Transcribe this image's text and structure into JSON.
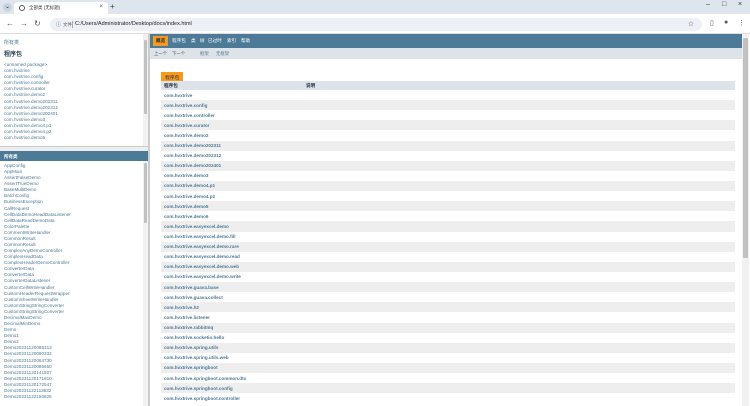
{
  "browser": {
    "tab_title": "全部类 (无标题)",
    "new_tab": "+",
    "omnibox_label": "文件",
    "url": "C:/Users/Administrator/Desktop/docs/index.html"
  },
  "left": {
    "all_packages": "所有类",
    "packages_heading": "程序包",
    "packages": [
      "<unnamed package>",
      "com.hvxtrive",
      "com.hvxtrive.config",
      "com.hvxtrive.controller",
      "com.hvxtrive.curator",
      "com.hvxtrive.demo2",
      "com.hvxtrive.demo202311",
      "com.hvxtrive.demo202312",
      "com.hvxtrive.demo202401",
      "com.hvxtrive.demo3",
      "com.hvxtrive.demo4.p1",
      "com.hvxtrive.demo4.p2",
      "com.hvxtrive.demo5"
    ],
    "classes_heading": "所有类",
    "classes": [
      "AppConfig",
      "AppMain",
      "AssertFalseDemo",
      "AssertTrueDemo",
      "BaseMultiDemo",
      "BatchConfig",
      "BusinessException",
      "CallRequest",
      "CellDataDemoHeadDataListener",
      "CellDataReadDemoData",
      "ColorPalette",
      "CommentWriteHandler",
      "CommonResult",
      "CommonResult",
      "ComplexAnyDemoController",
      "ComplexHeadData",
      "ComplexHeaderDemoController",
      "ConverterData",
      "ConverterData",
      "ConverterDataListener",
      "CustomCellWriteHandler",
      "CustomHeaderRequestWrapper",
      "CustomSheetWriteHandler",
      "CustomStringStringConverter",
      "CustomStringStringConverter",
      "DecimalMaxDemo",
      "DecimalMinDemo",
      "Demo",
      "Demo1",
      "Demo2",
      "Demo20231120085313",
      "Demo20231120090332",
      "Demo20231120084730",
      "Demo20231120085650",
      "Demo20231120141507",
      "Demo20231120171810",
      "Demo20231120172547",
      "Demo20231122113632",
      "Demo20231122150825"
    ]
  },
  "topnav": {
    "items": [
      "概览",
      "程序包",
      "类",
      "树",
      "已过时",
      "索引",
      "帮助"
    ],
    "active_index": 0
  },
  "subnav": {
    "prev": "上一个",
    "next": "下一个",
    "frames": "框架",
    "noframes": "无框架"
  },
  "summary": {
    "caption": "程序包",
    "col_package": "程序包",
    "col_desc": "说明",
    "rows": [
      "com.hvxtrive",
      "com.hvxtrive.config",
      "com.hvxtrive.controller",
      "com.hvxtrive.curator",
      "com.hvxtrive.demo2",
      "com.hvxtrive.demo202311",
      "com.hvxtrive.demo202312",
      "com.hvxtrive.demo202401",
      "com.hvxtrive.demo3",
      "com.hvxtrive.demo4.p1",
      "com.hvxtrive.demo4.p2",
      "com.hvxtrive.demo5",
      "com.hvxtrive.demo6",
      "com.hvxtrive.easyexcel.demo",
      "com.hvxtrive.easyexcel.demo.fill",
      "com.hvxtrive.easyexcel.demo.rare",
      "com.hvxtrive.easyexcel.demo.read",
      "com.hvxtrive.easyexcel.demo.web",
      "com.hvxtrive.easyexcel.demo.write",
      "com.hvxtrive.guava.base",
      "com.hvxtrive.guava.collect",
      "com.hvxtrive.h2",
      "com.hvxtrive.listener",
      "com.hvxtrive.rabbitmq",
      "com.hvxtrive.socketio.hello",
      "com.hvxtrive.spring.utils",
      "com.hvxtrive.spring.utils.web",
      "com.hvxtrive.springboot",
      "com.hvxtrive.springboot.common.dto",
      "com.hvxtrive.springboot.config",
      "com.hvxtrive.springboot.controller"
    ]
  }
}
